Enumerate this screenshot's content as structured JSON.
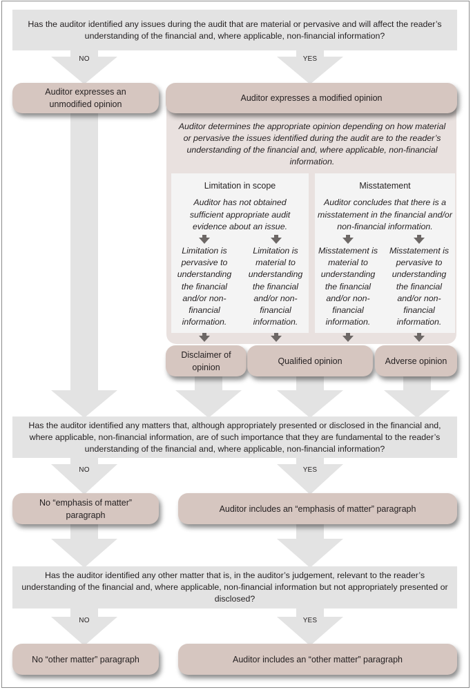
{
  "questions": {
    "q1": "Has the auditor identified any issues during the audit that are material or pervasive and will affect the reader’s understanding of the financial and, where applicable, non-financial information?",
    "q2": "Has the auditor identified any matters that, although appropriately presented or disclosed in the financial and, where applicable, non-financial information, are of such importance that they are fundamental to the reader’s understanding of the financial and, where applicable, non-financial information?",
    "q3": "Has the auditor identified any other matter that is, in the auditor’s judgement, relevant to the reader’s understanding of the financial and, where applicable, non-financial information but not appropriately presented or disclosed?"
  },
  "branch_labels": {
    "no": "NO",
    "yes": "YES"
  },
  "stage1": {
    "unmodified": "Auditor expresses an unmodified opinion",
    "modified": "Auditor expresses a modified opinion",
    "intro": "Auditor determines the appropriate opinion depending on how material or pervasive the issues identified during the audit are to the reader’s understanding of the financial and, where applicable, non-financial information.",
    "limitation": {
      "title": "Limitation in scope",
      "description": "Auditor has not obtained sufficient appropriate audit evidence about an issue.",
      "pervasive": "Limitation is pervasive to understanding the financial and/or non-financial information.",
      "material": "Limitation is material to understanding the financial and/or non-financial information."
    },
    "misstatement": {
      "title": "Misstatement",
      "description": "Auditor concludes that there is a misstatement in the financial and/or non-financial information.",
      "material": "Misstatement is material to understanding the financial and/or non-financial information.",
      "pervasive": "Misstatement is pervasive to understanding the financial and/or non-financial information."
    },
    "outcomes": {
      "disclaimer": "Disclaimer of opinion",
      "qualified": "Qualified opinion",
      "adverse": "Adverse opinion"
    }
  },
  "stage2": {
    "no": "No “emphasis of matter” paragraph",
    "yes": "Auditor includes an “emphasis of matter” paragraph"
  },
  "stage3": {
    "no": "No “other matter” paragraph",
    "yes": "Auditor includes an “other matter” paragraph"
  },
  "colors": {
    "question_box": "#e3e3e3",
    "flow_arrow": "#e3e3e3",
    "outcome_pill": "#d6c6c0",
    "panel": "#e9e1df",
    "column": "#f4f4f4",
    "small_arrow": "#6d6866"
  }
}
